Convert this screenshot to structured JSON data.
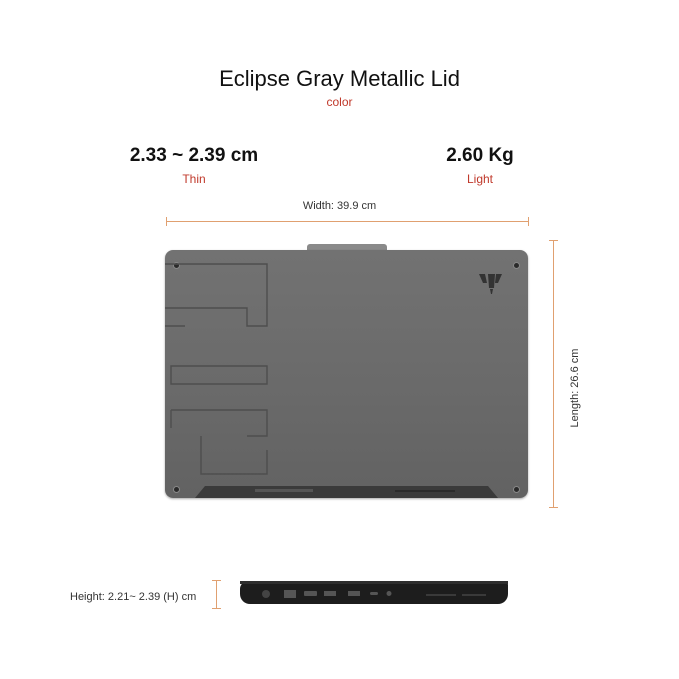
{
  "heading": {
    "title": "Eclipse Gray Metallic Lid",
    "subtitle": "color"
  },
  "specs": {
    "thickness": {
      "value": "2.33 ~ 2.39 cm",
      "label": "Thin"
    },
    "weight": {
      "value": "2.60 Kg",
      "label": "Light"
    }
  },
  "dimensions": {
    "width": "Width: 39.9 cm",
    "length": "Length: 26.6 cm",
    "height": "Height: 2.21~ 2.39 (H) cm"
  },
  "colors": {
    "accent": "#c0392b",
    "measure_line": "#e0a070",
    "lid": "#6b6b6b",
    "chassis_side": "#1d1d1d"
  },
  "icons": [
    "tuf-logo-icon",
    "laptop-lid-image",
    "laptop-side-profile-image"
  ]
}
